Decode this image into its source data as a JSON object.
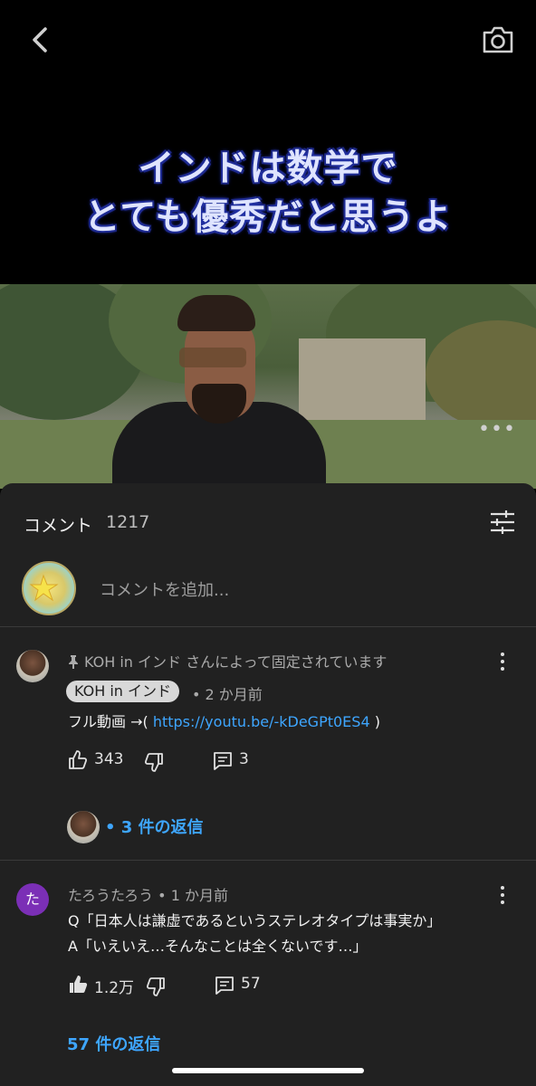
{
  "video": {
    "caption_line1": "インドは数学で",
    "caption_line2": "とても優秀だと思うよ",
    "more_dots": "•••"
  },
  "comments_header": {
    "title": "コメント",
    "count": "1217"
  },
  "add_comment": {
    "placeholder": "コメントを追加..."
  },
  "comments": [
    {
      "pinned_text": "KOH in インド さんによって固定されています",
      "author": "KOH in インド",
      "time": "• 2 か月前",
      "text_prefix": "フル動画 →( ",
      "link": "https://youtu.be/-kDeGPt0ES4",
      "text_suffix": " )",
      "likes": "343",
      "replies": "3",
      "replies_link": "• 3 件の返信"
    },
    {
      "author_initial": "た",
      "author_time": "たろうたろう • 1 か月前",
      "line1": "Q「日本人は謙虚であるというステレオタイプは事実か」",
      "line2": "A「いえいえ…そんなことは全くないです…」",
      "likes": "1.2万",
      "replies": "57",
      "replies_link": "57 件の返信"
    }
  ]
}
